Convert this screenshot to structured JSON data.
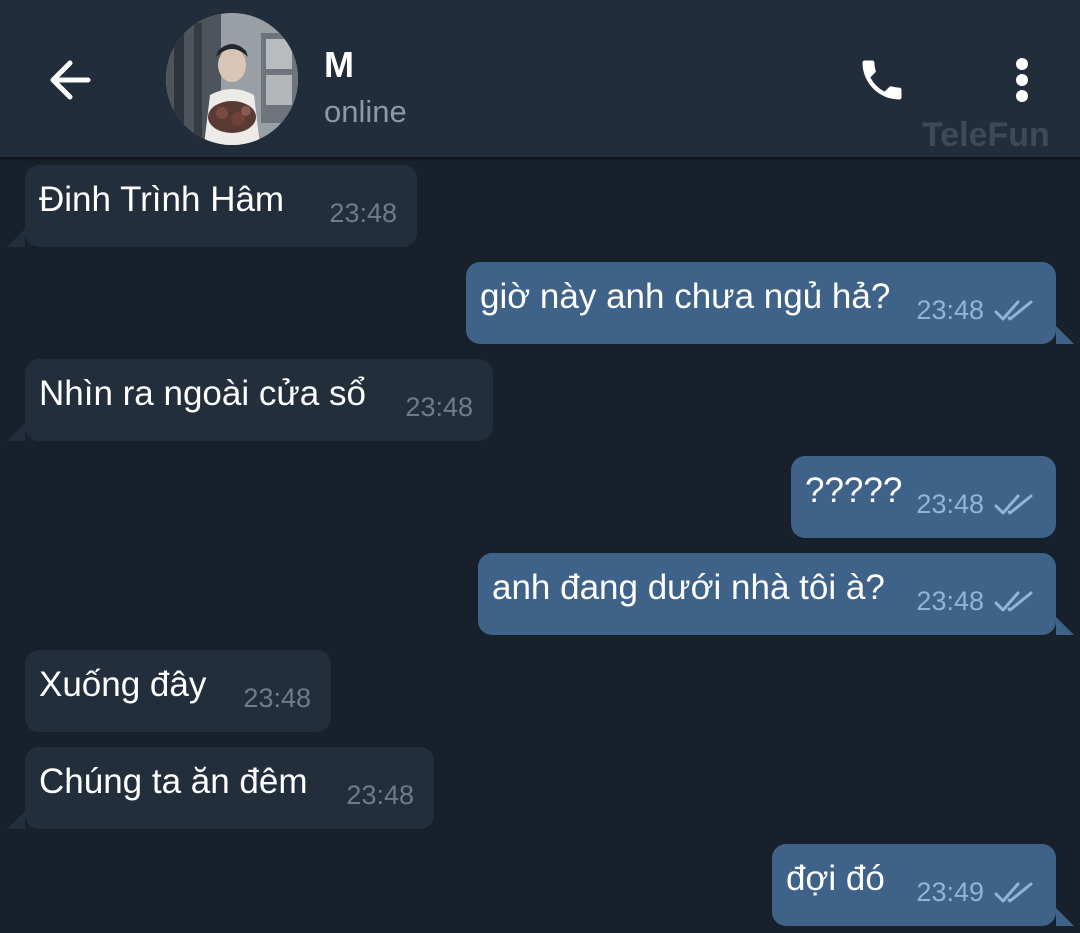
{
  "header": {
    "name": "M",
    "status": "online",
    "watermark": "TeleFun"
  },
  "icons": {
    "back": "back-arrow-icon",
    "call": "phone-icon",
    "menu": "more-vertical-icon",
    "read": "double-check-icon"
  },
  "colors": {
    "background": "#18202b",
    "header": "#212d3b",
    "incoming_bubble": "#222e3c",
    "outgoing_bubble": "#3f6289",
    "outgoing_time": "#90b3d8",
    "incoming_time": "#6d7b8c"
  },
  "messages": [
    {
      "direction": "in",
      "text": "Đinh Trình Hâm",
      "time": "23:48"
    },
    {
      "direction": "out",
      "text": "giờ này anh chưa ngủ hả?",
      "time": "23:48",
      "read": true
    },
    {
      "direction": "in",
      "text": "Nhìn ra ngoài cửa sổ",
      "time": "23:48"
    },
    {
      "direction": "out",
      "text": "?????",
      "time": "23:48",
      "read": true
    },
    {
      "direction": "out",
      "text": "anh đang dưới nhà tôi à?",
      "time": "23:48",
      "read": true
    },
    {
      "direction": "in",
      "text": "Xuống đây",
      "time": "23:48"
    },
    {
      "direction": "in",
      "text": "Chúng ta ăn đêm",
      "time": "23:48"
    },
    {
      "direction": "out",
      "text": "đợi đó",
      "time": "23:49",
      "read": true
    }
  ]
}
